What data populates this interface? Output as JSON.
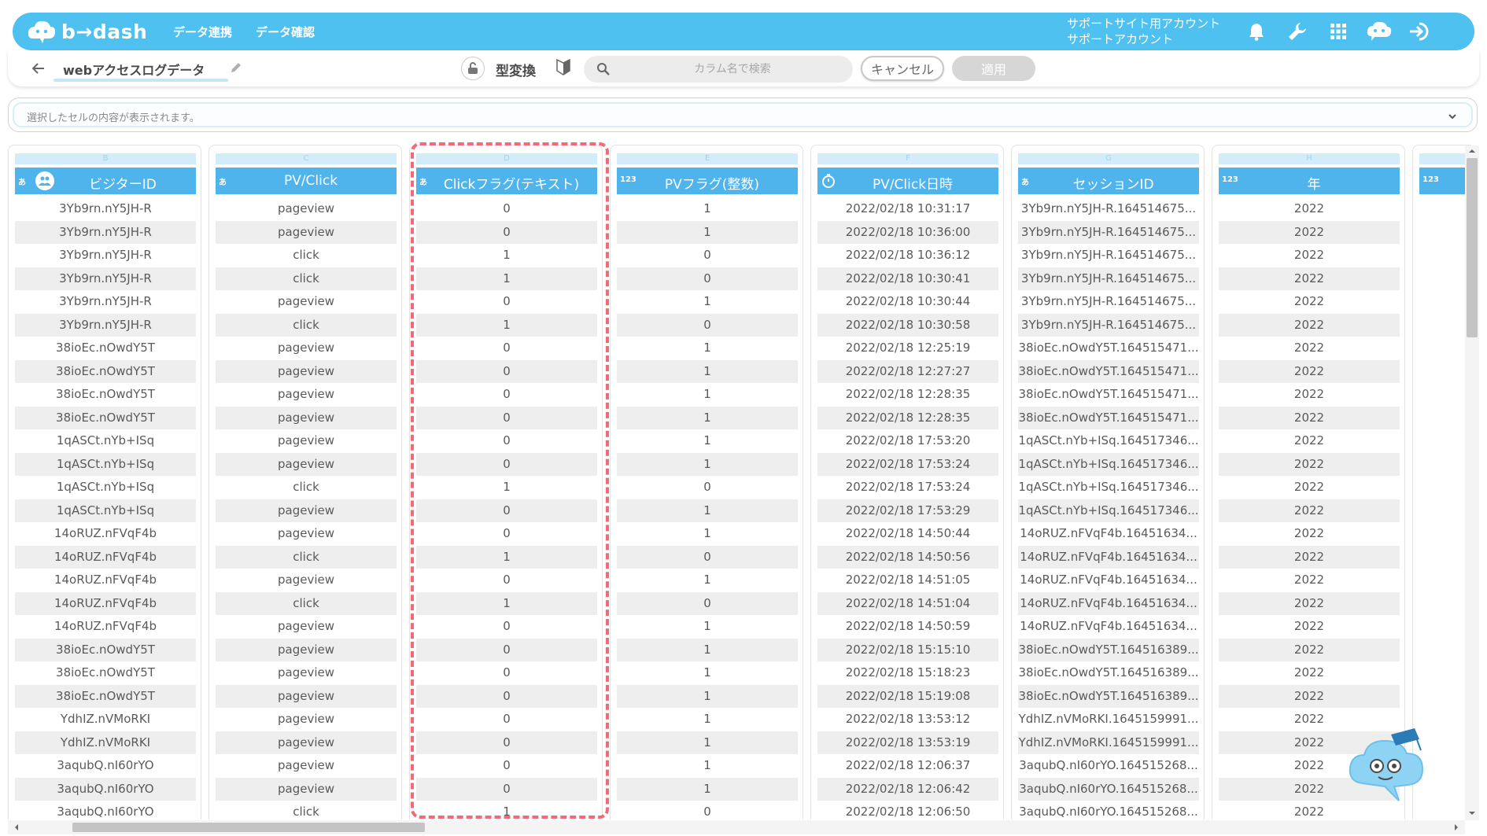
{
  "header": {
    "brand": "b→dash",
    "nav": [
      "データ連携",
      "データ確認"
    ],
    "account_line1": "サポートサイト用アカウント",
    "account_line2": "サポートアカウント",
    "accent_color": "#4fc1f1"
  },
  "toolbar": {
    "dataset_title": "webアクセスログデータ",
    "type_convert_label": "型変換",
    "search_placeholder": "カラム名で検索",
    "search_value": "",
    "cancel_label": "キャンセル",
    "apply_label": "適用"
  },
  "cellbar": {
    "placeholder": "選択したセルの内容が表示されます。"
  },
  "columns": [
    {
      "letter": "B",
      "type": "あ",
      "name": "ビジターID",
      "values": [
        "3Yb9rn.nY5JH-R",
        "3Yb9rn.nY5JH-R",
        "3Yb9rn.nY5JH-R",
        "3Yb9rn.nY5JH-R",
        "3Yb9rn.nY5JH-R",
        "3Yb9rn.nY5JH-R",
        "38ioEc.nOwdY5T",
        "38ioEc.nOwdY5T",
        "38ioEc.nOwdY5T",
        "38ioEc.nOwdY5T",
        "1qASCt.nYb+ISq",
        "1qASCt.nYb+ISq",
        "1qASCt.nYb+ISq",
        "1qASCt.nYb+ISq",
        "14oRUZ.nFVqF4b",
        "14oRUZ.nFVqF4b",
        "14oRUZ.nFVqF4b",
        "14oRUZ.nFVqF4b",
        "14oRUZ.nFVqF4b",
        "38ioEc.nOwdY5T",
        "38ioEc.nOwdY5T",
        "38ioEc.nOwdY5T",
        "YdhIZ.nVMoRKI",
        "YdhIZ.nVMoRKI",
        "3aqubQ.nI60rYO",
        "3aqubQ.nI60rYO",
        "3aqubQ.nI60rYO"
      ]
    },
    {
      "letter": "C",
      "type": "あ",
      "name": "PV/Click",
      "values": [
        "pageview",
        "pageview",
        "click",
        "click",
        "pageview",
        "click",
        "pageview",
        "pageview",
        "pageview",
        "pageview",
        "pageview",
        "pageview",
        "click",
        "pageview",
        "pageview",
        "click",
        "pageview",
        "click",
        "pageview",
        "pageview",
        "pageview",
        "pageview",
        "pageview",
        "pageview",
        "pageview",
        "pageview",
        "click"
      ]
    },
    {
      "letter": "D",
      "type": "あ",
      "name": "Clickフラグ(テキスト)",
      "values": [
        "0",
        "0",
        "1",
        "1",
        "0",
        "1",
        "0",
        "0",
        "0",
        "0",
        "0",
        "0",
        "1",
        "0",
        "0",
        "1",
        "0",
        "1",
        "0",
        "0",
        "0",
        "0",
        "0",
        "0",
        "0",
        "0",
        "1"
      ]
    },
    {
      "letter": "E",
      "type": "123",
      "name": "PVフラグ(整数)",
      "values": [
        "1",
        "1",
        "0",
        "0",
        "1",
        "0",
        "1",
        "1",
        "1",
        "1",
        "1",
        "1",
        "0",
        "1",
        "1",
        "0",
        "1",
        "0",
        "1",
        "1",
        "1",
        "1",
        "1",
        "1",
        "1",
        "1",
        "0"
      ]
    },
    {
      "letter": "F",
      "type": "clock",
      "name": "PV/Click日時",
      "values": [
        "2022/02/18 10:31:17",
        "2022/02/18 10:36:00",
        "2022/02/18 10:36:12",
        "2022/02/18 10:30:41",
        "2022/02/18 10:30:44",
        "2022/02/18 10:30:58",
        "2022/02/18 12:25:19",
        "2022/02/18 12:27:27",
        "2022/02/18 12:28:35",
        "2022/02/18 12:28:35",
        "2022/02/18 17:53:20",
        "2022/02/18 17:53:24",
        "2022/02/18 17:53:24",
        "2022/02/18 17:53:29",
        "2022/02/18 14:50:44",
        "2022/02/18 14:50:56",
        "2022/02/18 14:51:05",
        "2022/02/18 14:51:04",
        "2022/02/18 14:50:59",
        "2022/02/18 15:15:10",
        "2022/02/18 15:18:23",
        "2022/02/18 15:19:08",
        "2022/02/18 13:53:12",
        "2022/02/18 13:53:19",
        "2022/02/18 12:06:37",
        "2022/02/18 12:06:42",
        "2022/02/18 12:06:50"
      ]
    },
    {
      "letter": "G",
      "type": "あ",
      "name": "セッションID",
      "values": [
        "3Yb9rn.nY5JH-R.164514675...",
        "3Yb9rn.nY5JH-R.164514675...",
        "3Yb9rn.nY5JH-R.164514675...",
        "3Yb9rn.nY5JH-R.164514675...",
        "3Yb9rn.nY5JH-R.164514675...",
        "3Yb9rn.nY5JH-R.164514675...",
        "38ioEc.nOwdY5T.164515471...",
        "38ioEc.nOwdY5T.164515471...",
        "38ioEc.nOwdY5T.164515471...",
        "38ioEc.nOwdY5T.164515471...",
        "1qASCt.nYb+ISq.164517346...",
        "1qASCt.nYb+ISq.164517346...",
        "1qASCt.nYb+ISq.164517346...",
        "1qASCt.nYb+ISq.164517346...",
        "14oRUZ.nFVqF4b.16451634...",
        "14oRUZ.nFVqF4b.16451634...",
        "14oRUZ.nFVqF4b.16451634...",
        "14oRUZ.nFVqF4b.16451634...",
        "14oRUZ.nFVqF4b.16451634...",
        "38ioEc.nOwdY5T.164516389...",
        "38ioEc.nOwdY5T.164516389...",
        "38ioEc.nOwdY5T.164516389...",
        "YdhIZ.nVMoRKI.1645159991...",
        "YdhIZ.nVMoRKI.1645159991...",
        "3aqubQ.nI60rYO.164515268...",
        "3aqubQ.nI60rYO.164515268...",
        "3aqubQ.nI60rYO.164515268..."
      ]
    },
    {
      "letter": "H",
      "type": "123",
      "name": "年",
      "values": [
        "2022",
        "2022",
        "2022",
        "2022",
        "2022",
        "2022",
        "2022",
        "2022",
        "2022",
        "2022",
        "2022",
        "2022",
        "2022",
        "2022",
        "2022",
        "2022",
        "2022",
        "2022",
        "2022",
        "2022",
        "2022",
        "2022",
        "2022",
        "2022",
        "2022",
        "2022",
        "2022"
      ]
    },
    {
      "letter": "",
      "type": "123",
      "name": "",
      "values": []
    }
  ],
  "icons": {
    "header": [
      "bell-icon",
      "wrench-icon",
      "grid-icon",
      "chat-bot-icon",
      "logout-icon"
    ],
    "highlight_color": "#ef6b77"
  }
}
